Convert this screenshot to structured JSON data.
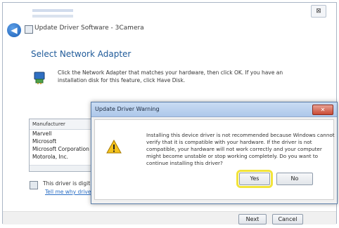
{
  "window": {
    "close_label": "⊠",
    "back_icon": "back-arrow-icon",
    "title": "Update Driver Software - 3Camera"
  },
  "page": {
    "heading": "Select Network Adapter",
    "instructions": "Click the Network Adapter that matches your hardware, then click OK. If you have an installation disk for this feature, click Have Disk.",
    "manufacturer_header": "Manufacturer",
    "manufacturers": [
      "Marvell",
      "Microsoft",
      "Microsoft Corporation",
      "Motorola, Inc."
    ],
    "signed_text": "This driver is digit",
    "signed_link": "Tell me why driver"
  },
  "footer": {
    "next_label": "Next",
    "cancel_label": "Cancel"
  },
  "dialog": {
    "title": "Update Driver Warning",
    "close_label": "✕",
    "message": "Installing this device driver is not recommended because Windows cannot verify that it is compatible with your hardware. If the driver is not compatible, your hardware will not work correctly and your computer might become unstable or stop working completely. Do you want to continue installing this driver?",
    "yes_label": "Yes",
    "no_label": "No",
    "highlight_color": "#f2e43a"
  },
  "icons": [
    "back-arrow-icon",
    "network-adapter-icon",
    "warning-icon",
    "driver-signed-icon"
  ]
}
